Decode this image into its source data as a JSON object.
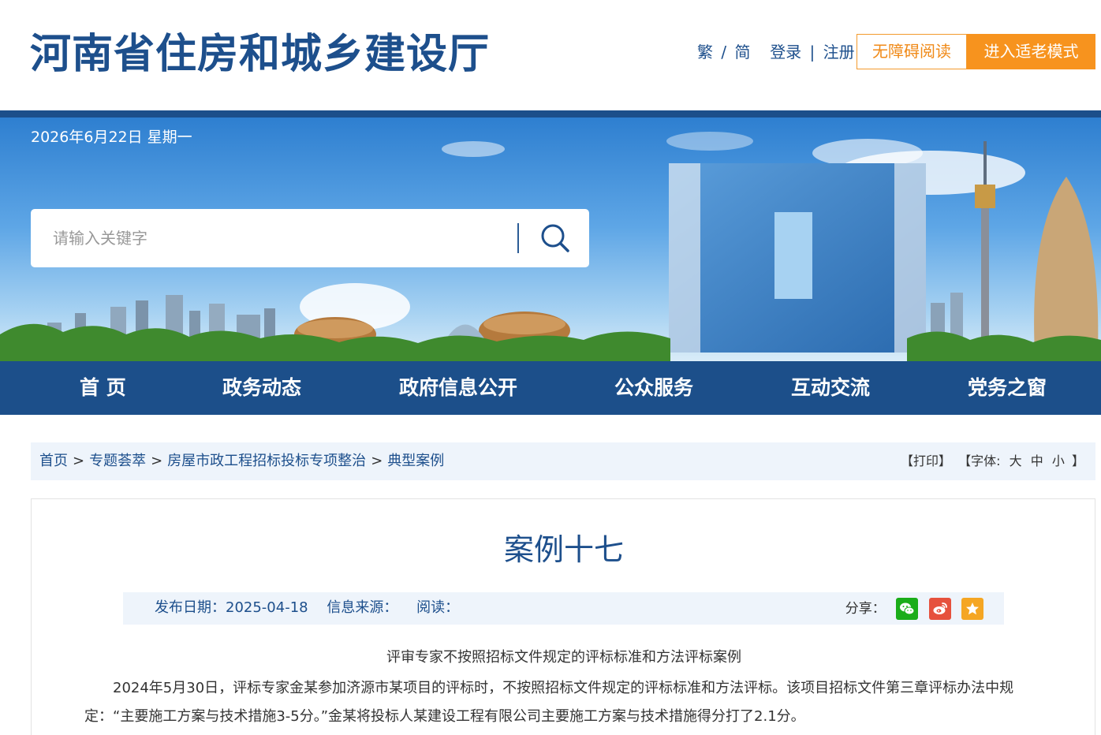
{
  "header": {
    "site_title": "河南省住房和城乡建设厅",
    "traditional": "繁",
    "slash": "/",
    "simplified": "简",
    "login": "登录",
    "bar": "|",
    "register": "注册",
    "accessible_reading": "无障碍阅读",
    "elder_mode": "进入适老模式"
  },
  "banner": {
    "date": "2026年6月22日 星期一",
    "search_placeholder": "请输入关键字"
  },
  "nav": {
    "items": [
      {
        "label": "首 页"
      },
      {
        "label": "政务动态"
      },
      {
        "label": "政府信息公开"
      },
      {
        "label": "公众服务"
      },
      {
        "label": "互动交流"
      },
      {
        "label": "党务之窗"
      }
    ]
  },
  "breadcrumb": {
    "items": [
      "首页",
      "专题荟萃",
      "房屋市政工程招标投标专项整治",
      "典型案例"
    ],
    "arrow": ">"
  },
  "tools": {
    "print": "【打印】",
    "font_label": "【字体:",
    "font_large": "大",
    "font_medium": "中",
    "font_small": "小",
    "font_close": "】"
  },
  "article": {
    "title": "案例十七",
    "publish_date": "发布日期：2025-04-18",
    "source": "信息来源：",
    "reads": "阅读：",
    "share_label": "分享：",
    "subtitle": "评审专家不按照招标文件规定的评标标准和方法评标案例",
    "paragraph": "2024年5月30日，评标专家金某参加济源市某项目的评标时，不按照招标文件规定的评标标准和方法评标。该项目招标文件第三章评标办法中规定：“主要施工方案与技术措施3-5分。”金某将投标人某建设工程有限公司主要施工方案与技术措施得分打了2.1分。"
  },
  "colors": {
    "brand_blue": "#1c4f8a",
    "accent_orange": "#f7931e",
    "wechat_green": "#1aad19",
    "weibo_red": "#e6513d",
    "favorite_yellow": "#f5a623"
  }
}
